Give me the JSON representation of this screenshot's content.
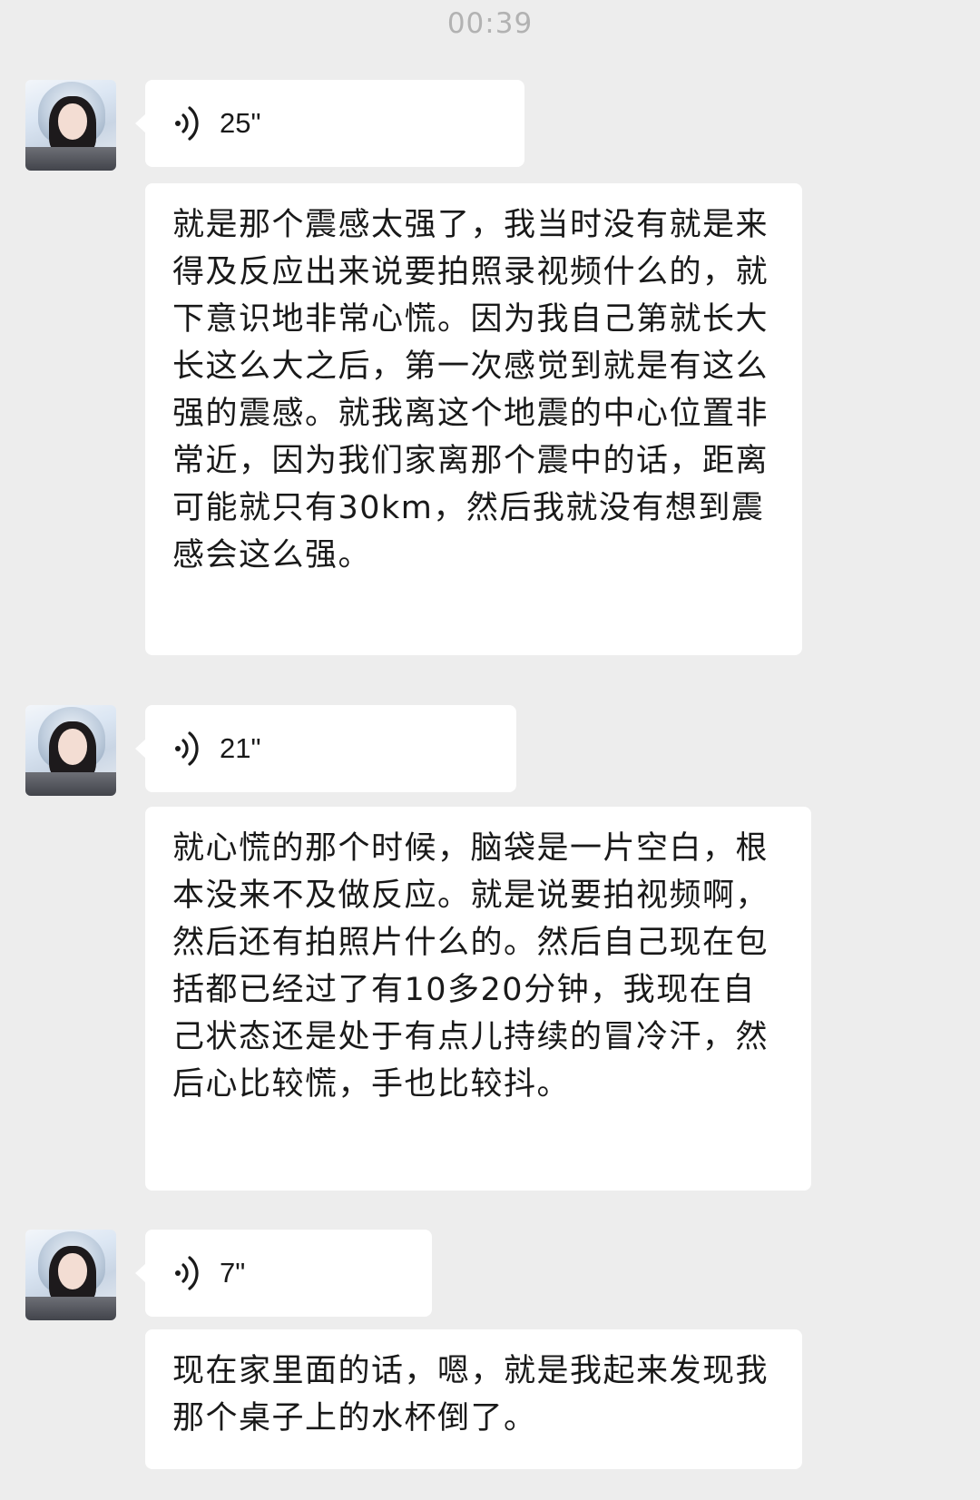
{
  "timestamp": "00:39",
  "messages": [
    {
      "voice": {
        "icon": "voice-wave-icon",
        "duration": "25\""
      },
      "text": "就是那个震感太强了，我当时没有就是来得及反应出来说要拍照录视频什么的，就下意识地非常心慌。因为我自己第就长大长这么大之后，第一次感觉到就是有这么强的震感。就我离这个地震的中心位置非常近，因为我们家离那个震中的话，距离可能就只有30km，然后我就没有想到震感会这么强。"
    },
    {
      "voice": {
        "icon": "voice-wave-icon",
        "duration": "21\""
      },
      "text": "就心慌的那个时候，脑袋是一片空白，根本没来不及做反应。就是说要拍视频啊，然后还有拍照片什么的。然后自己现在包括都已经过了有10多20分钟，我现在自己状态还是处于有点儿持续的冒冷汗，然后心比较慌，手也比较抖。"
    },
    {
      "voice": {
        "icon": "voice-wave-icon",
        "duration": "7\""
      },
      "text": "现在家里面的话，嗯，就是我起来发现我那个桌子上的水杯倒了。"
    }
  ]
}
